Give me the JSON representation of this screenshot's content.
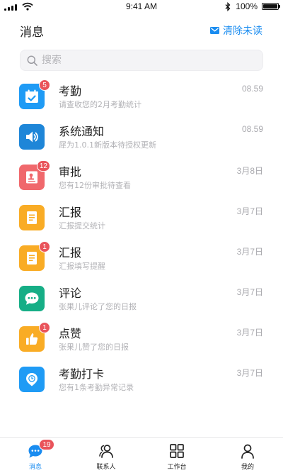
{
  "status_bar": {
    "time": "9:41 AM",
    "battery": "100%"
  },
  "header": {
    "title": "消息",
    "mark_read_label": "清除未读"
  },
  "search": {
    "placeholder": "搜索"
  },
  "colors": {
    "accent": "#1a8cf0",
    "badge": "#e9545b"
  },
  "messages": [
    {
      "title": "考勤",
      "subtitle": "请查收您的2月考勤统计",
      "time": "08.59",
      "badge": "5",
      "icon": "calendar-check-icon",
      "color": "#1f9bf5"
    },
    {
      "title": "系统通知",
      "subtitle": "犀为1.0.1新版本待授权更新",
      "time": "08.59",
      "badge": "",
      "icon": "speaker-icon",
      "color": "#1e86d8"
    },
    {
      "title": "审批",
      "subtitle": "您有12份审批待查看",
      "time": "3月8日",
      "badge": "12",
      "icon": "approval-stamp-icon",
      "color": "#f0686c"
    },
    {
      "title": "汇报",
      "subtitle": "汇报提交统计",
      "time": "3月7日",
      "badge": "",
      "icon": "report-document-icon",
      "color": "#f9ac25"
    },
    {
      "title": "汇报",
      "subtitle": "汇报填写提醒",
      "time": "3月7日",
      "badge": "1",
      "icon": "report-document-icon",
      "color": "#f9ac25"
    },
    {
      "title": "评论",
      "subtitle": "张果儿评论了您的日报",
      "time": "3月7日",
      "badge": "",
      "icon": "comment-bubble-icon",
      "color": "#16ae86"
    },
    {
      "title": "点赞",
      "subtitle": "张果儿赞了您的日报",
      "time": "3月7日",
      "badge": "1",
      "icon": "thumbs-up-icon",
      "color": "#f9ac25"
    },
    {
      "title": "考勤打卡",
      "subtitle": "您有1条考勤异常记录",
      "time": "3月7日",
      "badge": "",
      "icon": "location-clock-icon",
      "color": "#1f9bf5"
    }
  ],
  "tabs": [
    {
      "label": "消息",
      "icon": "chat-bubble-icon",
      "badge": "19",
      "active": true
    },
    {
      "label": "联系人",
      "icon": "contacts-icon",
      "badge": "",
      "active": false
    },
    {
      "label": "工作台",
      "icon": "grid-icon",
      "badge": "",
      "active": false
    },
    {
      "label": "我的",
      "icon": "user-icon",
      "badge": "",
      "active": false
    }
  ]
}
